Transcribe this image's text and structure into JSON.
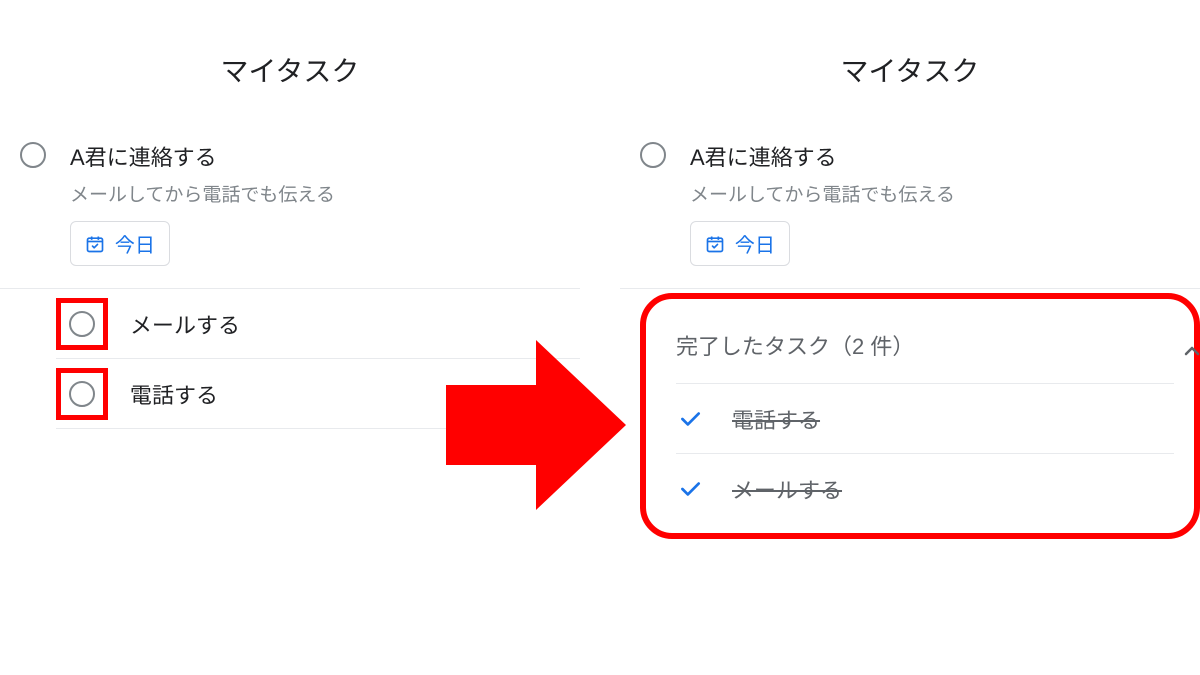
{
  "left": {
    "title": "マイタスク",
    "task": {
      "title": "A君に連絡する",
      "subtitle": "メールしてから電話でも伝える",
      "chip": "今日"
    },
    "subtasks": [
      "メールする",
      "電話する"
    ]
  },
  "right": {
    "title": "マイタスク",
    "task": {
      "title": "A君に連絡する",
      "subtitle": "メールしてから電話でも伝える",
      "chip": "今日"
    },
    "completed": {
      "header": "完了したタスク（2 件）",
      "items": [
        "電話する",
        "メールする"
      ]
    }
  }
}
